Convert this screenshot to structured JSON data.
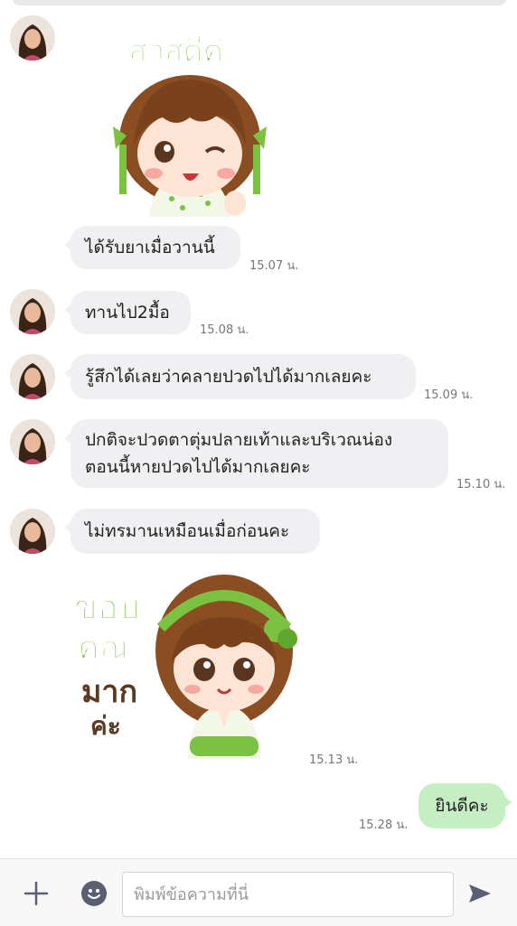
{
  "chat": {
    "messages": [
      {
        "type": "sticker",
        "caption": "สวัสดีค่ะ",
        "time": ""
      },
      {
        "type": "text",
        "text": "ได้รับยาเมื่อวานนี้",
        "time": "15.07 น."
      },
      {
        "type": "text",
        "text": "ทานไป2มื้อ",
        "time": "15.08 น."
      },
      {
        "type": "text",
        "text": "รู้สึกได้เลยว่าคลายปวดไปได้มากเลยคะ",
        "time": "15.09 น."
      },
      {
        "type": "text",
        "lines": [
          "ปกติจะปวดตาตุ่มปลายเท้าและบริเวณน่อง",
          "ตอนนี้หายปวดไปได้มากเลยคะ"
        ],
        "time": "15.10 น."
      },
      {
        "type": "text",
        "text": "ไม่ทรมานเหมือนเมื่อก่อนคะ",
        "time": ""
      },
      {
        "type": "sticker",
        "caption_lines": [
          "ขอบ",
          "คุณ",
          "มาก",
          "ค่ะ"
        ],
        "time": "15.13 น."
      },
      {
        "type": "text",
        "direction": "out",
        "text": "ยินดีคะ",
        "time": "15.28 น."
      }
    ]
  },
  "composer": {
    "placeholder": "พิมพ์ข้อความที่นี่",
    "plus_icon": "plus-icon",
    "emoji_icon": "emoji-icon",
    "send_icon": "send-icon"
  },
  "colors": {
    "incoming_bubble": "#f0f0f3",
    "outgoing_bubble": "#c5eec3",
    "sticker_green": "#7cc242",
    "sticker_hair": "#8a4e22"
  }
}
